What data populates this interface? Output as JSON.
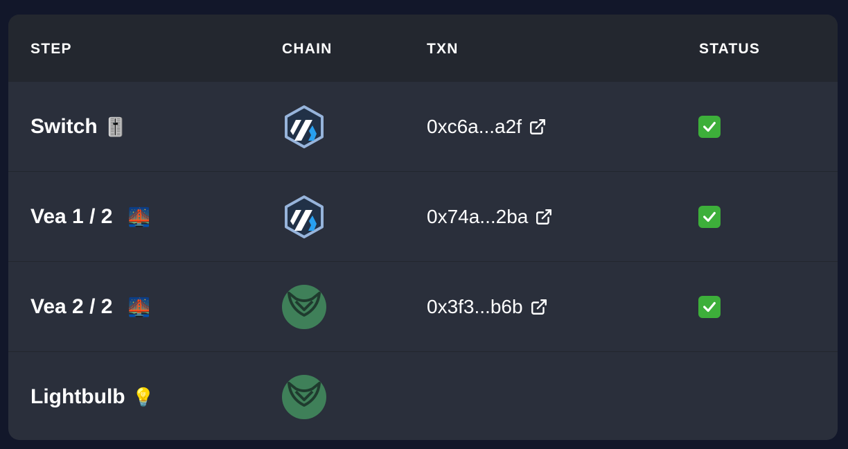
{
  "table": {
    "headers": {
      "step": "STEP",
      "chain": "CHAIN",
      "txn": "TXN",
      "status": "STATUS"
    },
    "rows": [
      {
        "step": "Switch",
        "emoji": "🎚️",
        "chain": "arbitrum",
        "txn": "0xc6a...a2f",
        "status": "done"
      },
      {
        "step": "Vea 1 / 2",
        "emoji": "🌉",
        "chain": "arbitrum",
        "txn": "0x74a...2ba",
        "status": "done"
      },
      {
        "step": "Vea 2 / 2",
        "emoji": "🌉",
        "chain": "gnosis",
        "txn": "0x3f3...b6b",
        "status": "done"
      },
      {
        "step": "Lightbulb",
        "emoji": "💡",
        "chain": "gnosis",
        "txn": "",
        "status": ""
      }
    ]
  },
  "colors": {
    "background": "#12172a",
    "card": "#2a2f3b",
    "header": "#23272f",
    "gnosis": "#3f8059",
    "arbitrum_outline": "#97b4db",
    "arbitrum_blue": "#28a0f0",
    "check": "#3daf3a"
  }
}
